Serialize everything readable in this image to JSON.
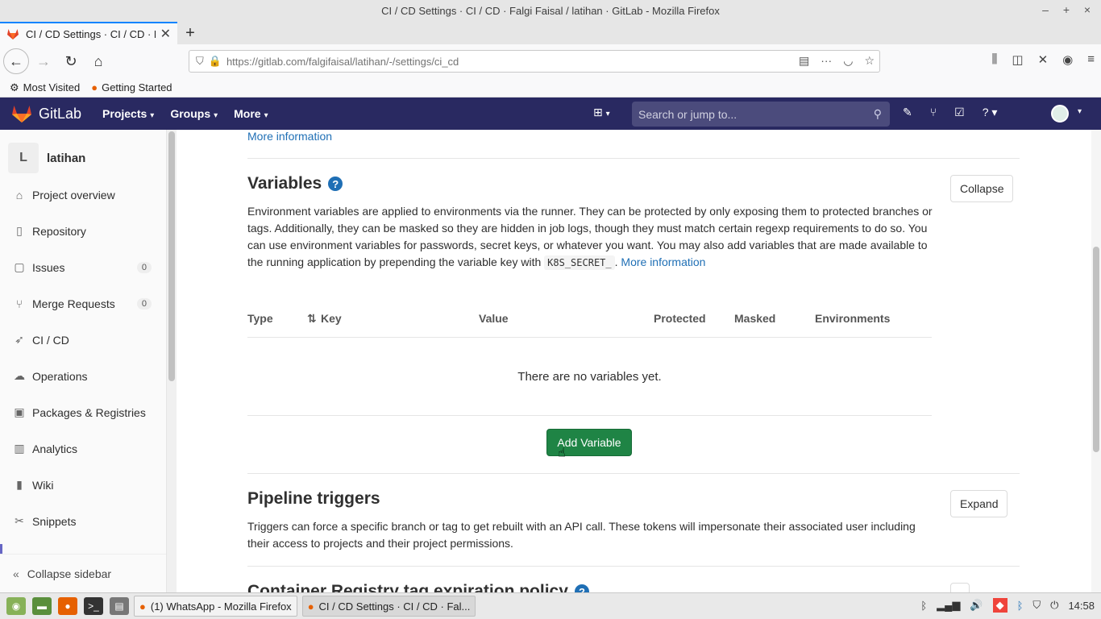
{
  "window": {
    "title": "CI / CD Settings · CI / CD · Falgi Faisal / latihan · GitLab - Mozilla Firefox",
    "controls": [
      "–",
      "+",
      "×"
    ]
  },
  "browser": {
    "tab_title": "CI / CD Settings · CI / CD · Fal",
    "url_host": "https://gitlab.com",
    "url_path": "/falgifaisal/latihan/-/settings/ci_cd",
    "bookmarks": [
      "Most Visited",
      "Getting Started"
    ]
  },
  "gitlab_header": {
    "brand": "GitLab",
    "nav": [
      "Projects",
      "Groups",
      "More"
    ],
    "search_placeholder": "Search or jump to..."
  },
  "sidebar": {
    "project_initial": "L",
    "project_name": "latihan",
    "items": [
      {
        "label": "Project overview",
        "icon": "home-icon"
      },
      {
        "label": "Repository",
        "icon": "doc-icon"
      },
      {
        "label": "Issues",
        "icon": "issues-icon",
        "count": "0"
      },
      {
        "label": "Merge Requests",
        "icon": "merge-icon",
        "count": "0"
      },
      {
        "label": "CI / CD",
        "icon": "rocket-icon"
      },
      {
        "label": "Operations",
        "icon": "cloud-icon"
      },
      {
        "label": "Packages & Registries",
        "icon": "package-icon"
      },
      {
        "label": "Analytics",
        "icon": "chart-icon"
      },
      {
        "label": "Wiki",
        "icon": "book-icon"
      },
      {
        "label": "Snippets",
        "icon": "snippet-icon"
      }
    ],
    "collapse_label": "Collapse sidebar"
  },
  "main": {
    "top_more_info": "More information",
    "variables": {
      "title": "Variables",
      "button": "Collapse",
      "desc_1": "Environment variables are applied to environments via the runner. They can be protected by only exposing them to protected branches or tags. Additionally, they can be masked so they are hidden in job logs, though they must match certain regexp requirements to do so. You can use environment variables for passwords, secret keys, or whatever you want. You may also add variables that are made available to the running application by prepending the variable key with",
      "code": "K8S_SECRET_",
      "desc_link": "More information",
      "columns": [
        "Type",
        "Key",
        "Value",
        "Protected",
        "Masked",
        "Environments"
      ],
      "empty": "There are no variables yet.",
      "add_button": "Add Variable"
    },
    "triggers": {
      "title": "Pipeline triggers",
      "button": "Expand",
      "desc": "Triggers can force a specific branch or tag to get rebuilt with an API call. These tokens will impersonate their associated user including their access to projects and their project permissions."
    },
    "next_section_title": "Container Registry tag expiration policy"
  },
  "taskbar": {
    "windows": [
      "(1) WhatsApp - Mozilla Firefox",
      "CI / CD Settings · CI / CD · Fal..."
    ],
    "clock": "14:58"
  },
  "colors": {
    "gitlab_header": "#292961",
    "link": "#1f6fb5",
    "add_button": "#1f8445"
  }
}
